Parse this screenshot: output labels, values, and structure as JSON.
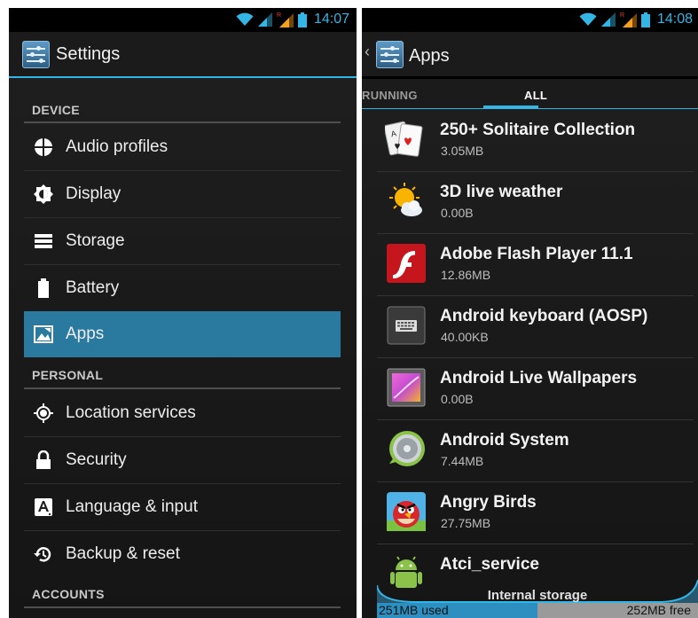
{
  "settings_screen": {
    "status_time": "14:07",
    "title": "Settings",
    "sections": [
      {
        "header": "DEVICE",
        "items": [
          {
            "label": "Audio profiles",
            "icon": "audio-profiles-icon"
          },
          {
            "label": "Display",
            "icon": "display-icon"
          },
          {
            "label": "Storage",
            "icon": "storage-icon"
          },
          {
            "label": "Battery",
            "icon": "battery-icon"
          },
          {
            "label": "Apps",
            "icon": "apps-icon",
            "selected": true
          }
        ]
      },
      {
        "header": "PERSONAL",
        "items": [
          {
            "label": "Location services",
            "icon": "location-icon"
          },
          {
            "label": "Security",
            "icon": "lock-icon"
          },
          {
            "label": "Language & input",
            "icon": "language-icon"
          },
          {
            "label": "Backup & reset",
            "icon": "backup-icon"
          }
        ]
      },
      {
        "header": "ACCOUNTS",
        "items": []
      }
    ]
  },
  "apps_screen": {
    "status_time": "14:08",
    "title": "Apps",
    "tabs": [
      {
        "label": "RUNNING",
        "active": false
      },
      {
        "label": "ALL",
        "active": true
      }
    ],
    "apps": [
      {
        "name": "250+ Solitaire Collection",
        "size": "3.05MB",
        "icon": "solitaire-cards-icon"
      },
      {
        "name": "3D live weather",
        "size": "0.00B",
        "icon": "weather-sun-cloud-icon"
      },
      {
        "name": "Adobe Flash Player 11.1",
        "size": "12.86MB",
        "icon": "flash-player-icon"
      },
      {
        "name": "Android keyboard (AOSP)",
        "size": "40.00KB",
        "icon": "keyboard-icon"
      },
      {
        "name": "Android Live Wallpapers",
        "size": "0.00B",
        "icon": "live-wallpaper-icon"
      },
      {
        "name": "Android System",
        "size": "7.44MB",
        "icon": "android-system-icon"
      },
      {
        "name": "Angry Birds",
        "size": "27.75MB",
        "icon": "angry-bird-icon"
      },
      {
        "name": "Atci_service",
        "size": "",
        "icon": "android-robot-icon"
      }
    ],
    "storage": {
      "label": "Internal storage",
      "used": "251MB used",
      "free": "252MB free",
      "used_fraction": 0.499
    }
  },
  "colors": {
    "accent": "#33b5e5",
    "selected_item": "#2a7aa0",
    "background": "#1a1a1a"
  }
}
